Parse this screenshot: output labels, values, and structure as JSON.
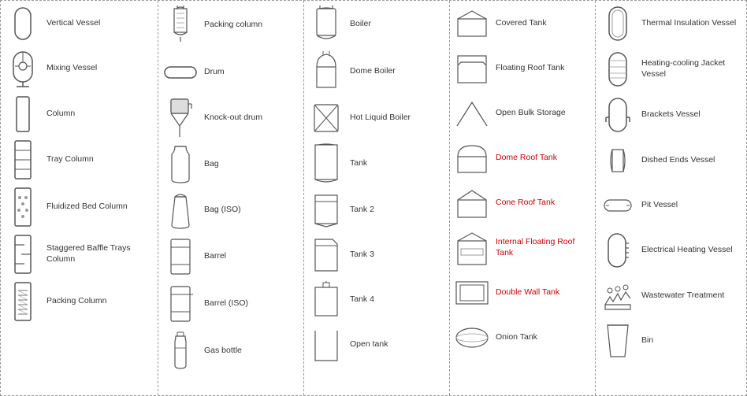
{
  "columns": [
    {
      "id": "col1",
      "items": [
        {
          "id": "vertical-vessel",
          "label": "Vertical Vessel",
          "icon": "vertical-vessel"
        },
        {
          "id": "mixing-vessel",
          "label": "Mixing Vessel",
          "icon": "mixing-vessel"
        },
        {
          "id": "column",
          "label": "Column",
          "icon": "column"
        },
        {
          "id": "tray-column",
          "label": "Tray Column",
          "icon": "tray-column"
        },
        {
          "id": "fluidized-bed-column",
          "label": "Fluidized Bed Column",
          "icon": "fluidized-bed-column"
        },
        {
          "id": "staggered-baffle-trays-column",
          "label": "Staggered Baffle\nTrays Column",
          "icon": "staggered-baffle-trays-column"
        },
        {
          "id": "packing-column-col1",
          "label": "Packing Column",
          "icon": "packing-column-col1"
        }
      ]
    },
    {
      "id": "col2",
      "items": [
        {
          "id": "packing-column",
          "label": "Packing column",
          "icon": "packing-column"
        },
        {
          "id": "drum",
          "label": "Drum",
          "icon": "drum"
        },
        {
          "id": "knock-out-drum",
          "label": "Knock-out drum",
          "icon": "knock-out-drum"
        },
        {
          "id": "bag",
          "label": "Bag",
          "icon": "bag"
        },
        {
          "id": "bag-iso",
          "label": "Bag (ISO)",
          "icon": "bag-iso"
        },
        {
          "id": "barrel",
          "label": "Barrel",
          "icon": "barrel"
        },
        {
          "id": "barrel-iso",
          "label": "Barrel (ISO)",
          "icon": "barrel-iso"
        },
        {
          "id": "gas-bottle",
          "label": "Gas bottle",
          "icon": "gas-bottle"
        }
      ]
    },
    {
      "id": "col3",
      "items": [
        {
          "id": "boiler",
          "label": "Boiler",
          "icon": "boiler"
        },
        {
          "id": "dome-boiler",
          "label": "Dome Boiler",
          "icon": "dome-boiler"
        },
        {
          "id": "hot-liquid-boiler",
          "label": "Hot Liquid Boiler",
          "icon": "hot-liquid-boiler"
        },
        {
          "id": "tank",
          "label": "Tank",
          "icon": "tank"
        },
        {
          "id": "tank2",
          "label": "Tank 2",
          "icon": "tank2"
        },
        {
          "id": "tank3",
          "label": "Tank 3",
          "icon": "tank3"
        },
        {
          "id": "tank4",
          "label": "Tank 4",
          "icon": "tank4"
        },
        {
          "id": "open-tank",
          "label": "Open tank",
          "icon": "open-tank"
        }
      ]
    },
    {
      "id": "col4",
      "items": [
        {
          "id": "covered-tank",
          "label": "Covered Tank",
          "icon": "covered-tank"
        },
        {
          "id": "floating-roof-tank",
          "label": "Floating Roof Tank",
          "icon": "floating-roof-tank"
        },
        {
          "id": "open-bulk-storage",
          "label": "Open Bulk Storage",
          "icon": "open-bulk-storage"
        },
        {
          "id": "dome-roof-tank",
          "label": "Dome Roof Tank",
          "icon": "dome-roof-tank",
          "red": true
        },
        {
          "id": "cone-roof-tank",
          "label": "Cone Roof Tank",
          "icon": "cone-roof-tank",
          "red": true
        },
        {
          "id": "internal-floating-roof-tank",
          "label": "Internal Floating\nRoof Tank",
          "icon": "internal-floating-roof-tank",
          "red": true
        },
        {
          "id": "double-wall-tank",
          "label": "Double Wall Tank",
          "icon": "double-wall-tank",
          "red": true
        },
        {
          "id": "onion-tank",
          "label": "Onion Tank",
          "icon": "onion-tank"
        }
      ]
    },
    {
      "id": "col5",
      "items": [
        {
          "id": "thermal-insulation-vessel",
          "label": "Thermal Insulation\nVessel",
          "icon": "thermal-insulation-vessel"
        },
        {
          "id": "heating-cooling-jacket-vessel",
          "label": "Heating-cooling\nJacket Vessel",
          "icon": "heating-cooling-jacket-vessel"
        },
        {
          "id": "brackets-vessel",
          "label": "Brackets Vessel",
          "icon": "brackets-vessel"
        },
        {
          "id": "dished-ends-vessel",
          "label": "Dished Ends Vessel",
          "icon": "dished-ends-vessel"
        },
        {
          "id": "pit-vessel",
          "label": "Pit Vessel",
          "icon": "pit-vessel"
        },
        {
          "id": "electrical-heating-vessel",
          "label": "Electrical Heating\nVessel",
          "icon": "electrical-heating-vessel"
        },
        {
          "id": "wastewater-treatment",
          "label": "Wastewater Treatment",
          "icon": "wastewater-treatment"
        },
        {
          "id": "bin",
          "label": "Bin",
          "icon": "bin"
        }
      ]
    }
  ]
}
